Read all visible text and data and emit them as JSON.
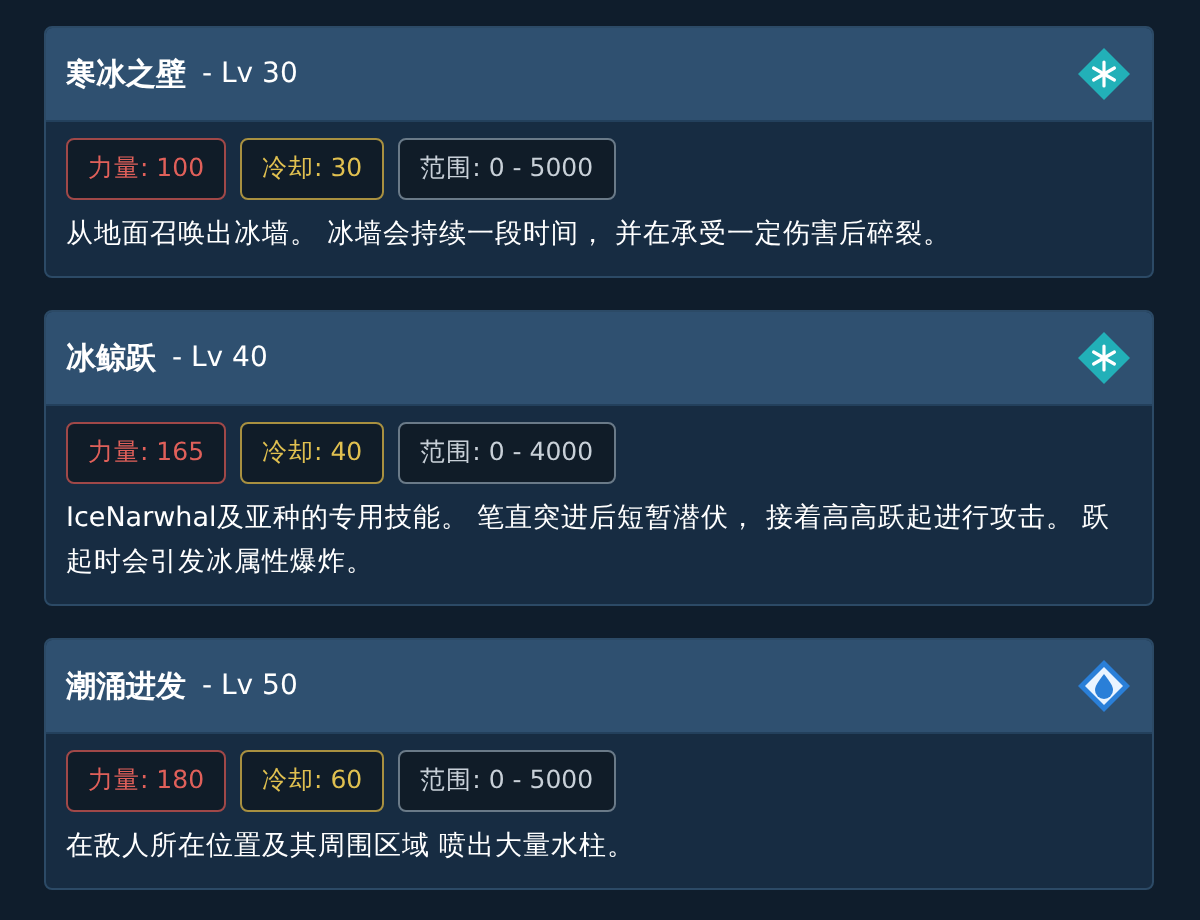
{
  "skills": [
    {
      "name": "寒冰之壁",
      "level": "- Lv 30",
      "kind": "ice",
      "stats": [
        {
          "kind": "power",
          "text": "力量: 100"
        },
        {
          "kind": "cooldown",
          "text": "冷却: 30"
        },
        {
          "kind": "range",
          "text": "范围: 0 - 5000"
        }
      ],
      "description": "从地面召唤出冰墙。 冰墙会持续一段时间， 并在承受一定伤害后碎裂。"
    },
    {
      "name": "冰鲸跃",
      "level": "- Lv 40",
      "kind": "ice",
      "stats": [
        {
          "kind": "power",
          "text": "力量: 165"
        },
        {
          "kind": "cooldown",
          "text": "冷却: 40"
        },
        {
          "kind": "range",
          "text": "范围: 0 - 4000"
        }
      ],
      "description": "IceNarwhal及亚种的专用技能。 笔直突进后短暂潜伏， 接着高高跃起进行攻击。 跃起时会引发冰属性爆炸。"
    },
    {
      "name": "潮涌进发",
      "level": "- Lv 50",
      "kind": "water",
      "stats": [
        {
          "kind": "power",
          "text": "力量: 180"
        },
        {
          "kind": "cooldown",
          "text": "冷却: 60"
        },
        {
          "kind": "range",
          "text": "范围: 0 - 5000"
        }
      ],
      "description": "在敌人所在位置及其周围区域 喷出大量水柱。"
    }
  ]
}
